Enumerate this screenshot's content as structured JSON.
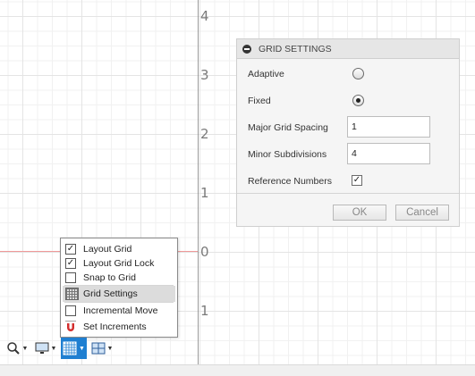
{
  "canvas": {
    "axis_labels": [
      "4",
      "3",
      "2",
      "1",
      "0",
      "1"
    ]
  },
  "dialog": {
    "title": "GRID SETTINGS",
    "adaptive_label": "Adaptive",
    "fixed_label": "Fixed",
    "selected_mode": "Fixed",
    "major_spacing_label": "Major Grid Spacing",
    "major_spacing_value": "1",
    "minor_subdivisions_label": "Minor Subdivisions",
    "minor_subdivisions_value": "4",
    "reference_numbers_label": "Reference Numbers",
    "reference_numbers_checked": true,
    "ok_label": "OK",
    "cancel_label": "Cancel"
  },
  "menu": {
    "items": [
      {
        "label": "Layout Grid",
        "checked": true
      },
      {
        "label": "Layout Grid Lock",
        "checked": true
      },
      {
        "label": "Snap to Grid",
        "checked": false
      },
      {
        "label": "Grid Settings",
        "icon": "grid-icon",
        "highlighted": true
      },
      {
        "label": "Incremental Move",
        "checked": false
      },
      {
        "label": "Set Increments",
        "icon": "magnet-icon"
      }
    ]
  },
  "toolbar": {
    "icons": [
      "zoom-icon",
      "display-icon",
      "grid-icon",
      "layout-icon"
    ],
    "active": "grid-icon",
    "accent": "#1f7fd1"
  },
  "colors": {
    "x_axis": "#ef9a9a",
    "y_axis": "#9a9a9a"
  }
}
